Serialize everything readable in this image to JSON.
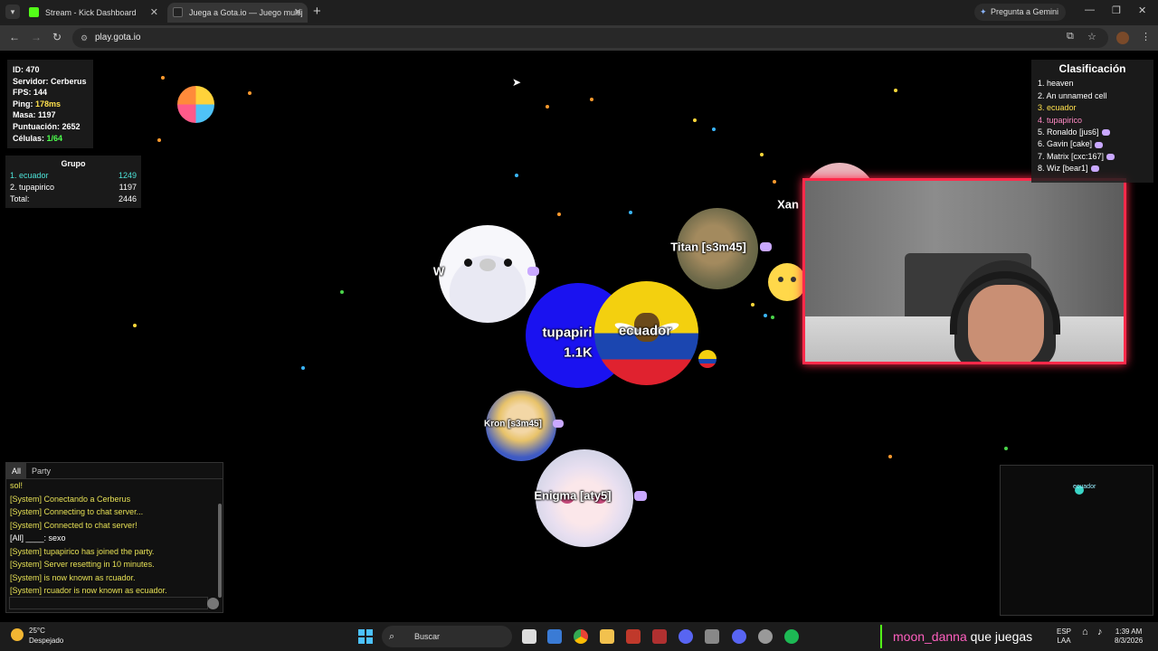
{
  "browser": {
    "tabs": [
      {
        "title": "Stream - Kick Dashboard",
        "active": false,
        "favicon_color": "#53fc18"
      },
      {
        "title": "Juega a Gota.io — Juego multij",
        "active": true,
        "favicon_color": "#222222"
      }
    ],
    "new_tab": "+",
    "gemini": "Pregunta a Gemini",
    "url": "play.gota.io"
  },
  "stats": {
    "id_label": "ID:",
    "id": "470",
    "server_label": "Servidor:",
    "server": "Cerberus",
    "fps_label": "FPS:",
    "fps": "144",
    "ping_label": "Ping:",
    "ping": "178ms",
    "mass_label": "Masa:",
    "mass": "1197",
    "score_label": "Puntuación:",
    "score": "2652",
    "cells_label": "Células:",
    "cells": "1/64"
  },
  "group": {
    "title": "Grupo",
    "members": [
      {
        "name": "1. ecuador",
        "mass": "1249"
      },
      {
        "name": "2. tupapirico",
        "mass": "1197"
      }
    ],
    "total_label": "Total:",
    "total": "2446"
  },
  "leaderboard": {
    "title": "Clasificación",
    "entries": [
      "1. heaven",
      "2. An unnamed cell",
      "3. ecuador",
      "4. tupapirico",
      "5. Ronaldo [jus6]",
      "6. Gavin [cake]",
      "7. Matrix [cxc:167]",
      "8. Wiz [bear1]"
    ]
  },
  "cells": {
    "tupapirico": {
      "name": "tupapiri",
      "mass": "1.1K"
    },
    "ecuador": {
      "name": "ecuador"
    },
    "walrus": {
      "name": "W"
    },
    "titan": {
      "name": "Titan [s3m45]"
    },
    "kron": {
      "name": "Kron [s3m45]"
    },
    "enigma": {
      "name": "Enigma [aty5]"
    },
    "xan": {
      "name": "Xan"
    }
  },
  "minimap": {
    "label": "ecuador"
  },
  "chat": {
    "tabs": [
      "All",
      "Party"
    ],
    "messages": [
      {
        "text": "sol!",
        "kind": "sys"
      },
      {
        "text": "[System] Conectando a Cerberus",
        "kind": "sys"
      },
      {
        "text": "[System] Connecting to chat server...",
        "kind": "sys"
      },
      {
        "text": "[System] Connected to chat server!",
        "kind": "sys"
      },
      {
        "text": "[All] ____: sexo",
        "kind": "all"
      },
      {
        "text": "[System] tupapirico has joined the party.",
        "kind": "sys"
      },
      {
        "text": "[System] Server resetting in 10 minutes.",
        "kind": "sys"
      },
      {
        "text": "[System] is now known as rcuador.",
        "kind": "sys"
      },
      {
        "text": "[System] rcuador is now known as ecuador.",
        "kind": "sys"
      }
    ]
  },
  "taskbar": {
    "temp": "25°C",
    "weather": "Despejado",
    "search": "Buscar",
    "stream_user": "moon_danna",
    "stream_msg": "que juegas",
    "lang": "ESP",
    "layout": "LAA",
    "time": "1:39 AM",
    "date": "8/3/2026"
  }
}
